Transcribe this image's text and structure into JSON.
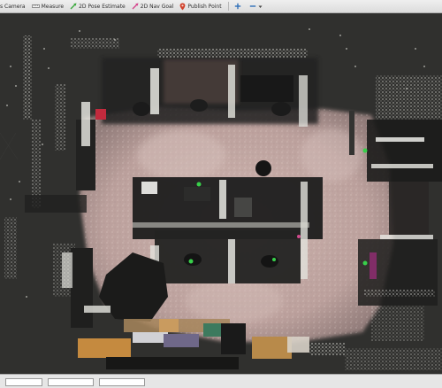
{
  "toolbar": {
    "tools": [
      {
        "label": "s Camera",
        "icon": "camera-icon"
      },
      {
        "label": "Measure",
        "icon": "ruler-icon"
      },
      {
        "label": "2D Pose Estimate",
        "icon": "green-arrow-icon"
      },
      {
        "label": "2D Nav Goal",
        "icon": "pink-arrow-icon"
      },
      {
        "label": "Publish Point",
        "icon": "map-pin-icon"
      }
    ],
    "colors": {
      "pose_arrow": "#39a83b",
      "goal_arrow": "#d4438c",
      "pin": "#d0402a",
      "plus": "#3070b8"
    }
  },
  "viewport": {
    "background": "#30302e",
    "floor_color": "#c9b1ae"
  },
  "statusbar": {
    "fields": [
      {
        "label": "",
        "value": ""
      },
      {
        "label": "",
        "value": ""
      },
      {
        "label": "",
        "value": ""
      }
    ]
  }
}
